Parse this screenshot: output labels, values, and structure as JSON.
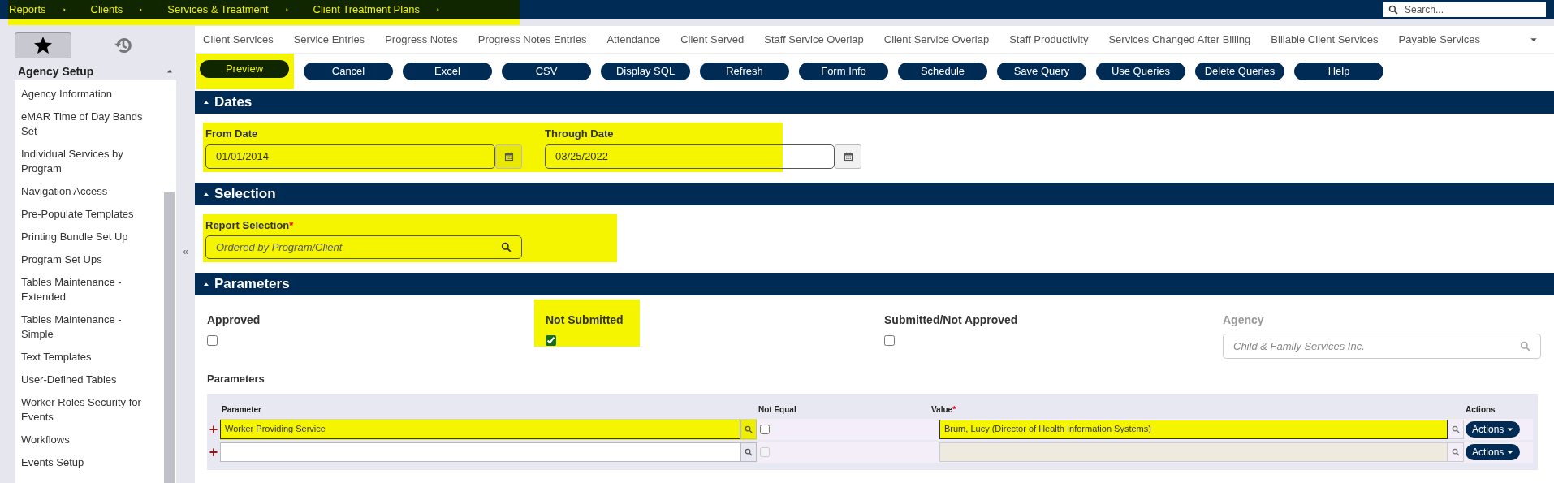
{
  "breadcrumbs": {
    "highlighted": true,
    "items": [
      "Reports",
      "Clients",
      "Services & Treatment",
      "Client Treatment Plans"
    ]
  },
  "search": {
    "placeholder": "Search..."
  },
  "sidebar": {
    "tabs": [
      {
        "kind": "favorites",
        "selected": true
      },
      {
        "kind": "history",
        "selected": false
      }
    ],
    "section": "Agency Setup",
    "collapse": "«",
    "items": [
      "Agency Information",
      "eMAR Time of Day Bands Set",
      "Individual Services by Program",
      "Navigation Access",
      "Pre-Populate Templates",
      "Printing Bundle Set Up",
      "Program Set Ups",
      "Tables Maintenance - Extended",
      "Tables Maintenance - Simple",
      "Text Templates",
      "User-Defined Tables",
      "Worker Roles Security for Events",
      "Workflows",
      "Events Setup"
    ]
  },
  "tabs": [
    "Client Services",
    "Service Entries",
    "Progress Notes",
    "Progress Notes Entries",
    "Attendance",
    "Client Served",
    "Staff Service Overlap",
    "Client Service Overlap",
    "Staff Productivity",
    "Services Changed After Billing",
    "Billable Client Services",
    "Payable Services"
  ],
  "buttons": [
    {
      "label": "Preview",
      "highlighted": true
    },
    {
      "label": "Cancel",
      "highlighted": false
    },
    {
      "label": "Excel",
      "highlighted": false
    },
    {
      "label": "CSV",
      "highlighted": false
    },
    {
      "label": "Display SQL",
      "highlighted": false
    },
    {
      "label": "Refresh",
      "highlighted": false
    },
    {
      "label": "Form Info",
      "highlighted": false
    },
    {
      "label": "Schedule",
      "highlighted": false
    },
    {
      "label": "Save Query",
      "highlighted": false
    },
    {
      "label": "Use Queries",
      "highlighted": false
    },
    {
      "label": "Delete Queries",
      "highlighted": false
    },
    {
      "label": "Help",
      "highlighted": false
    }
  ],
  "dates": {
    "title": "Dates",
    "highlighted": true,
    "fields": [
      {
        "label": "From Date",
        "value": "01/01/2014"
      },
      {
        "label": "Through Date",
        "value": "03/25/2022"
      }
    ]
  },
  "selection": {
    "title": "Selection",
    "highlighted": true,
    "field": {
      "label": "Report Selection",
      "required_mark": "*",
      "placeholder": "Ordered by Program/Client"
    }
  },
  "parameters": {
    "title": "Parameters",
    "options": [
      {
        "label": "Approved",
        "checked": false,
        "highlighted": false
      },
      {
        "label": "Not Submitted",
        "checked": true,
        "highlighted": true
      },
      {
        "label": "Submitted/Not Approved",
        "checked": false,
        "highlighted": false
      }
    ],
    "agency": {
      "label": "Agency",
      "placeholder": "Child & Family Services Inc.",
      "disabled": true
    },
    "table": {
      "title": "Parameters",
      "columns": [
        {
          "label": "Parameter"
        },
        {
          "label": "Not Equal"
        },
        {
          "label": "Value",
          "required_mark": "*"
        },
        {
          "label": "Actions"
        }
      ],
      "rows": [
        {
          "add_button": "+",
          "parameter": "Worker Providing Service",
          "not_equal": false,
          "not_equal_disabled": false,
          "value": "Brum, Lucy (Director of Health Information Systems)",
          "action": "Actions",
          "highlighted": true
        },
        {
          "add_button": "+",
          "not_equal": false,
          "not_equal_disabled": true,
          "action": "Actions",
          "highlighted": false
        }
      ]
    }
  }
}
